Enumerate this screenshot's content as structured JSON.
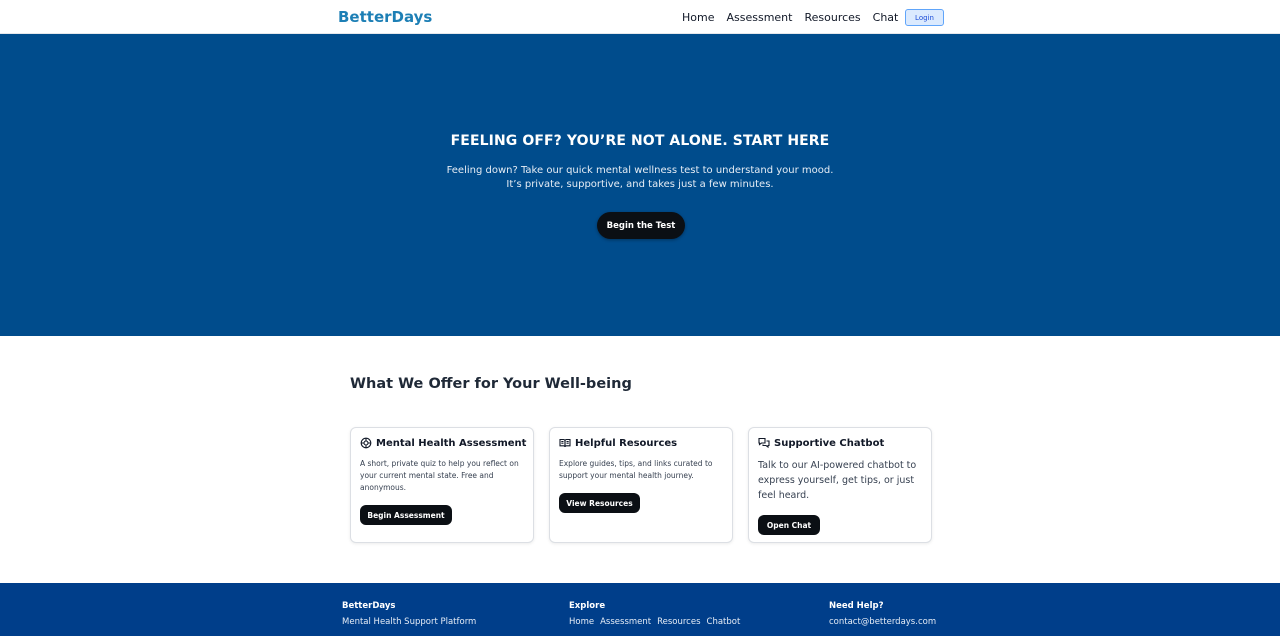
{
  "nav": {
    "brand": "BetterDays",
    "links": [
      "Home",
      "Assessment",
      "Resources",
      "Chat"
    ],
    "login": "Login"
  },
  "hero": {
    "title": "FEELING OFF? YOU’RE NOT ALONE. START HERE",
    "text": "Feeling down? Take our quick mental wellness test to understand your mood. It’s private, supportive, and takes just a few minutes.",
    "cta": "Begin the Test"
  },
  "offers": {
    "title": "What We Offer for Your Well-being",
    "cards": [
      {
        "icon": "brain-icon",
        "title": "Mental Health Assessment",
        "desc": "A short, private quiz to help you reflect on your current mental state. Free and anonymous.",
        "button": "Begin Assessment"
      },
      {
        "icon": "book-icon",
        "title": "Helpful Resources",
        "desc": "Explore guides, tips, and links curated to support your mental health journey.",
        "button": "View Resources"
      },
      {
        "icon": "chat-icon",
        "title": "Supportive Chatbot",
        "desc": "Talk to our AI-powered chatbot to express yourself, get tips, or just feel heard.",
        "button": "Open Chat"
      }
    ]
  },
  "footer": {
    "col1": {
      "heading": "BetterDays",
      "text": "Mental Health Support Platform"
    },
    "col2": {
      "heading": "Explore",
      "links": [
        "Home",
        "Assessment",
        "Resources",
        "Chatbot"
      ]
    },
    "col3": {
      "heading": "Need Help?",
      "text": "contact@betterdays.com"
    }
  },
  "colors": {
    "brand": "#1d7fb5",
    "hero_bg": "#004c8c",
    "footer_bg": "#003e8a",
    "button_dark": "#0b0f14"
  }
}
